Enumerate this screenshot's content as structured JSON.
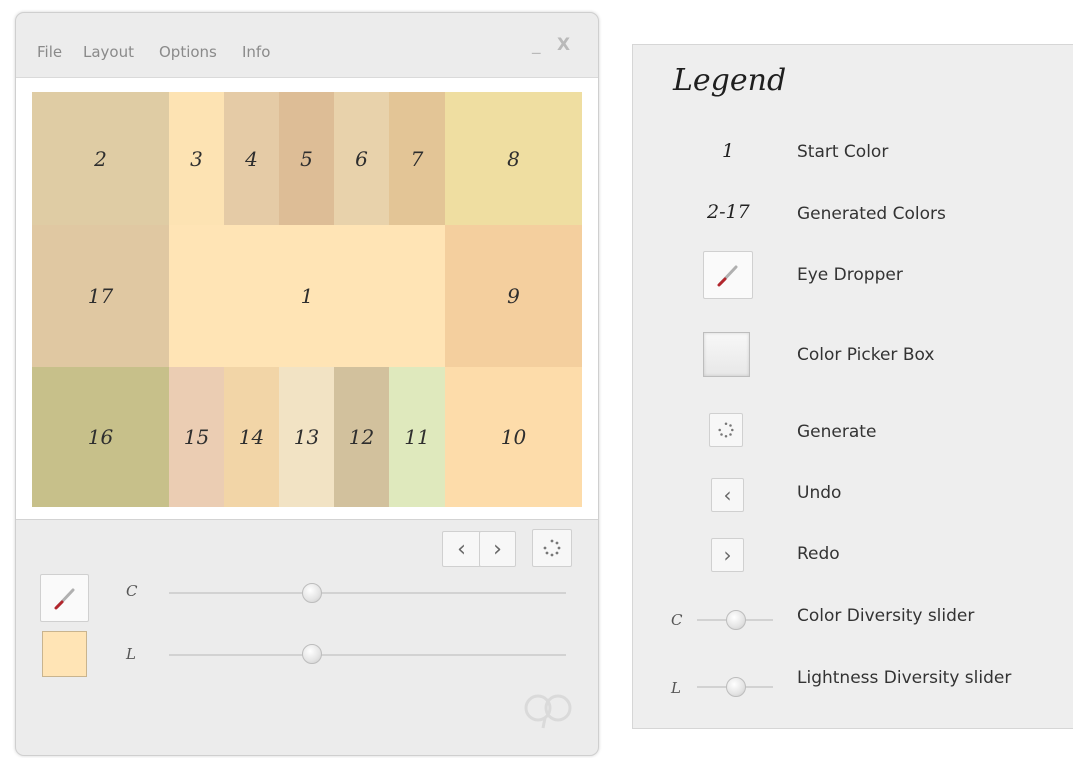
{
  "menu": {
    "file": "File",
    "layout": "Layout",
    "options": "Options",
    "info": "Info",
    "minimize": "_",
    "close": "X"
  },
  "swatches": [
    {
      "label": "2",
      "color": "#dfcca4"
    },
    {
      "label": "3",
      "color": "#fde3b3"
    },
    {
      "label": "4",
      "color": "#e5cba6"
    },
    {
      "label": "5",
      "color": "#ddbd96"
    },
    {
      "label": "6",
      "color": "#e8d2ab"
    },
    {
      "label": "7",
      "color": "#e3c596"
    },
    {
      "label": "8",
      "color": "#efdea1"
    },
    {
      "label": "17",
      "color": "#e0c8a2"
    },
    {
      "label": "1",
      "color": "#ffe4b5"
    },
    {
      "label": "9",
      "color": "#f4cf9e"
    },
    {
      "label": "16",
      "color": "#c7c08a"
    },
    {
      "label": "15",
      "color": "#ebcdb3"
    },
    {
      "label": "14",
      "color": "#f2d5a7"
    },
    {
      "label": "13",
      "color": "#f2e3c4"
    },
    {
      "label": "12",
      "color": "#d2c19d"
    },
    {
      "label": "11",
      "color": "#dfe9bd"
    },
    {
      "label": "10",
      "color": "#fddcaa"
    }
  ],
  "controls": {
    "undo_glyph": "‹",
    "redo_glyph": "›",
    "c_letter": "C",
    "l_letter": "L",
    "c_value": 0.36,
    "l_value": 0.36,
    "current_color": "#ffe4b5"
  },
  "legend": {
    "title": "Legend",
    "start_num": "1",
    "start_label": "Start Color",
    "generated_num": "2-17",
    "generated_label": "Generated Colors",
    "eyedropper_label": "Eye Dropper",
    "picker_label": "Color Picker Box",
    "generate_label": "Generate",
    "undo_label": "Undo",
    "redo_label": "Redo",
    "c_letter": "C",
    "c_label": "Color Diversity slider",
    "l_letter": "L",
    "l_label": "Lightness Diversity slider"
  }
}
